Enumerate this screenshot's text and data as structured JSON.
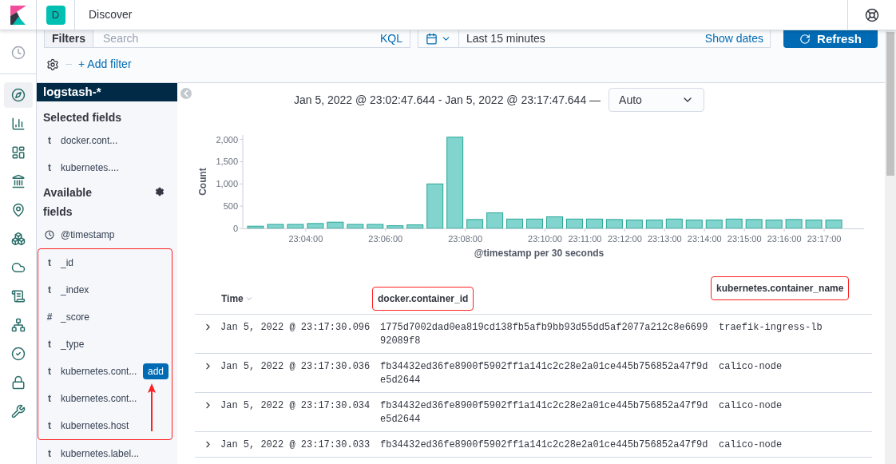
{
  "header": {
    "avatar": "D",
    "title": "Discover"
  },
  "nav_items": [
    {
      "kind": "recent",
      "selected": false
    },
    {
      "kind": "discover",
      "selected": true
    },
    {
      "kind": "visualize",
      "selected": false
    },
    {
      "kind": "dashboard",
      "selected": false
    },
    {
      "kind": "canvas",
      "selected": false
    },
    {
      "kind": "maps",
      "selected": false
    },
    {
      "kind": "ml",
      "selected": false
    },
    {
      "kind": "infra",
      "selected": false
    },
    {
      "kind": "logs",
      "selected": false
    },
    {
      "kind": "apm",
      "selected": false
    },
    {
      "kind": "uptime",
      "selected": false
    },
    {
      "kind": "siem",
      "selected": false
    },
    {
      "kind": "devtools",
      "selected": false
    }
  ],
  "query_bar": {
    "filters_label": "Filters",
    "search_placeholder": "Search",
    "language": "KQL",
    "time_range": "Last 15 minutes",
    "show_dates": "Show dates",
    "refresh": "Refresh"
  },
  "add_filter": "+ Add filter",
  "index_pattern": "logstash-*",
  "selected_fields": {
    "title": "Selected fields",
    "fields": [
      {
        "kind": "text",
        "type_label": "t",
        "name": "docker.cont..."
      },
      {
        "kind": "text",
        "type_label": "t",
        "name": "kubernetes...."
      }
    ]
  },
  "available_fields": {
    "title": "Available fields",
    "fields": [
      {
        "kind": "date",
        "name": "@timestamp"
      }
    ],
    "annotation_arrow": true,
    "highlighted_fields": [
      {
        "kind": "text",
        "type_label": "t",
        "name": "_id"
      },
      {
        "kind": "text",
        "type_label": "t",
        "name": "_index"
      },
      {
        "kind": "text",
        "type_label": "#",
        "name": "_score"
      },
      {
        "kind": "text",
        "type_label": "t",
        "name": "_type"
      },
      {
        "kind": "text",
        "type_label": "t",
        "name": "kubernetes.cont...",
        "action": "add"
      },
      {
        "kind": "text",
        "type_label": "t",
        "name": "kubernetes.cont..."
      },
      {
        "kind": "text",
        "type_label": "t",
        "name": "kubernetes.host"
      }
    ],
    "more_fields": [
      {
        "kind": "text",
        "type_label": "t",
        "name": "kubernetes.label..."
      }
    ]
  },
  "chart": {
    "range": "Jan 5, 2022 @ 23:02:47.644 - Jan 5, 2022 @ 23:17:47.644 —",
    "interval": "Auto",
    "chart_data": {
      "type": "bar",
      "xlabel": "@timestamp per 30 seconds",
      "ylabel": "Count",
      "categories": [
        null,
        null,
        null,
        "23:04:00",
        null,
        null,
        null,
        "23:06:00",
        null,
        null,
        null,
        "23:08:00",
        null,
        null,
        null,
        "23:10:00",
        null,
        "23:11:00",
        null,
        "23:12:00",
        null,
        "23:13:00",
        null,
        "23:14:00",
        null,
        "23:15:00",
        null,
        "23:16:00",
        null,
        "23:17:00"
      ],
      "series": [
        {
          "color": "#82d5ce",
          "values": [
            50,
            90,
            90,
            110,
            140,
            90,
            90,
            60,
            80,
            1000,
            2050,
            200,
            350,
            210,
            210,
            260,
            210,
            210,
            200,
            190,
            190,
            210,
            190,
            190,
            210,
            200,
            190,
            200,
            190,
            190
          ]
        }
      ],
      "ylim": [
        0,
        2100
      ],
      "yticks": [
        {
          "value": 0,
          "label": "0"
        },
        {
          "value": 500,
          "label": "500"
        },
        {
          "value": 1000,
          "label": "1,000"
        },
        {
          "value": 1500,
          "label": "1,500"
        },
        {
          "value": 2000,
          "label": "2,000"
        }
      ]
    }
  },
  "table": {
    "columns": [
      {
        "label": "Time",
        "sorted": true,
        "highlighted": false
      },
      {
        "label": "docker.container_id",
        "sorted": false,
        "highlighted": true
      },
      {
        "label": "kubernetes.container_name",
        "sorted": false,
        "highlighted": true
      }
    ],
    "rows": [
      {
        "time": "Jan 5, 2022 @ 23:17:30.096",
        "container_id": "1775d7002dad0ea819cd138fb5afb9bb93d55dd5af2077a212c8e669992089f8",
        "container_name": "traefik-ingress-lb"
      },
      {
        "time": "Jan 5, 2022 @ 23:17:30.036",
        "container_id": "fb34432ed36fe8900f5902ff1a141c2c28e2a01ce445b756852a47f9de5d2644",
        "container_name": "calico-node"
      },
      {
        "time": "Jan 5, 2022 @ 23:17:30.034",
        "container_id": "fb34432ed36fe8900f5902ff1a141c2c28e2a01ce445b756852a47f9de5d2644",
        "container_name": "calico-node"
      },
      {
        "time": "Jan 5, 2022 @ 23:17:30.033",
        "container_id": "fb34432ed36fe8900f5902ff1a141c2c28e2a01ce445b756852a47f9d",
        "container_name": "calico-node"
      }
    ]
  }
}
